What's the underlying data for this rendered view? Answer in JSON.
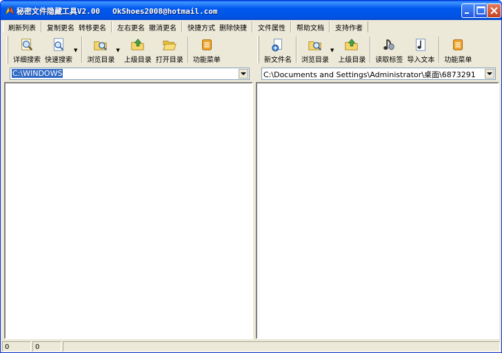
{
  "window": {
    "title": "秘密文件隐藏工具V2.00",
    "email": "OkShoes2008@hotmail.com"
  },
  "menu": {
    "groups": [
      [
        "刷新列表"
      ],
      [
        "复制更名",
        "转移更名"
      ],
      [
        "左右更名",
        "撤消更名"
      ],
      [
        "快捷方式",
        "删除快捷"
      ],
      [
        "文件属性"
      ],
      [
        "帮助文档"
      ],
      [
        "支持作者"
      ]
    ]
  },
  "left_toolbar": {
    "detail_search": "详细搜索",
    "quick_search": "快速搜索",
    "browse_dir": "浏览目录",
    "parent_dir": "上级目录",
    "open_dir": "打开目录",
    "func_menu": "功能菜单"
  },
  "right_toolbar": {
    "new_filename": "新文件名",
    "browse_dir": "浏览目录",
    "parent_dir": "上级目录",
    "read_tag": "读取标签",
    "import_text": "导入文本",
    "func_menu": "功能菜单"
  },
  "left_path": "C:\\WINDOWS",
  "right_path": "C:\\Documents and Settings\\Administrator\\桌面\\6873291",
  "status": {
    "left_count": "0",
    "right_count": "0",
    "message": ""
  },
  "colors": {
    "titlebar": "#0054e3",
    "window_bg": "#ece9d8",
    "selection": "#316ac5"
  }
}
